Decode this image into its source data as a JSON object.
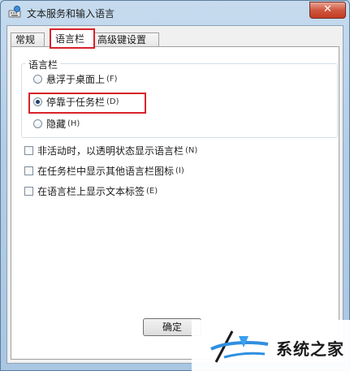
{
  "window": {
    "title": "文本服务和输入语言",
    "close_glyph": "✕"
  },
  "tabs": [
    {
      "label": "常规",
      "active": false
    },
    {
      "label": "语言栏",
      "active": true
    },
    {
      "label": "高级键设置",
      "active": false
    }
  ],
  "language_bar_group": {
    "legend": "语言栏",
    "options": [
      {
        "label": "悬浮于桌面上",
        "hotkey": "(F)",
        "checked": false
      },
      {
        "label": "停靠于任务栏",
        "hotkey": "(D)",
        "checked": true
      },
      {
        "label": "隐藏",
        "hotkey": "(H)",
        "checked": false
      }
    ]
  },
  "checkboxes": [
    {
      "label": "非活动时，以透明状态显示语言栏",
      "hotkey": "(N)",
      "checked": false
    },
    {
      "label": "在任务栏中显示其他语言栏图标",
      "hotkey": "(I)",
      "checked": false
    },
    {
      "label": "在语言栏上显示文本标签",
      "hotkey": "(E)",
      "checked": false
    }
  ],
  "buttons": {
    "ok": "确定"
  },
  "watermark": {
    "text": "系统之家"
  },
  "colors": {
    "highlight_red": "#d8222a",
    "titlebar_blue": "#b3cde6",
    "close_red": "#c23c22"
  }
}
